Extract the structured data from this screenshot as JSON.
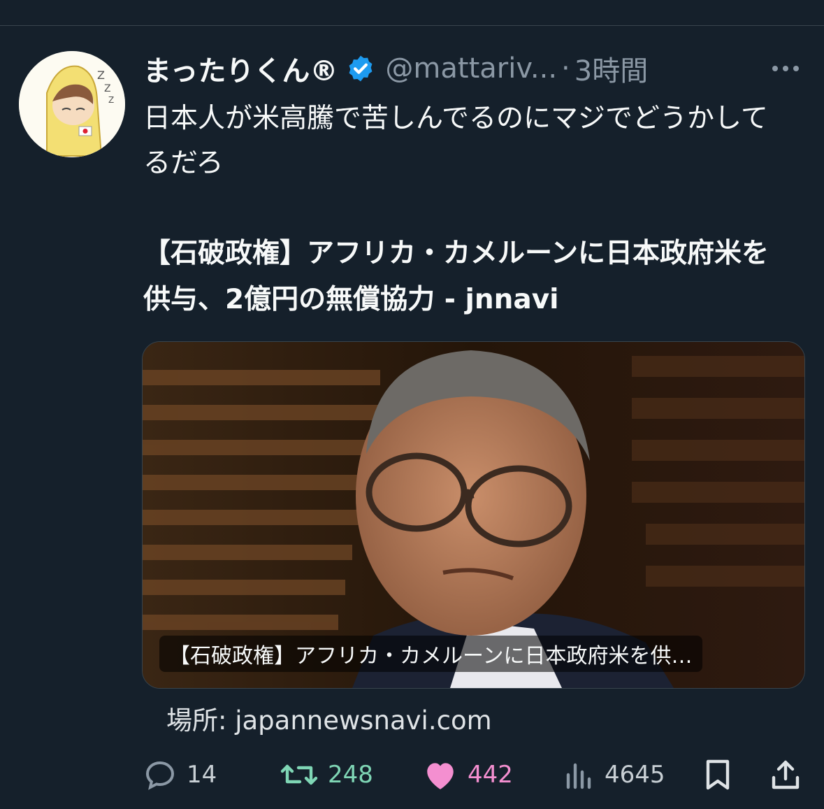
{
  "tweet": {
    "display_name": "まったりくん®",
    "handle": "@mattariv...",
    "separator": "·",
    "time": "3時間",
    "text": "日本人が米高騰で苦しんでるのにマジでどうかしてるだろ",
    "link_title": "【石破政権】アフリカ・カメルーンに日本政府米を供与、2億円の無償協力 - jnnavi"
  },
  "card": {
    "caption": "【石破政権】アフリカ・カメルーンに日本政府米を供…",
    "source": "場所: japannewsnavi.com"
  },
  "actions": {
    "reply_count": "14",
    "retweet_count": "248",
    "like_count": "442",
    "views_count": "4645"
  },
  "colors": {
    "background": "#15202b",
    "verified": "#1d9bf0",
    "retweet": "#7fd6b5",
    "like": "#f48fd0"
  },
  "icons": [
    "verified-badge-icon",
    "more-options-icon",
    "reply-icon",
    "retweet-icon",
    "like-icon",
    "views-icon",
    "bookmark-icon",
    "share-icon"
  ]
}
